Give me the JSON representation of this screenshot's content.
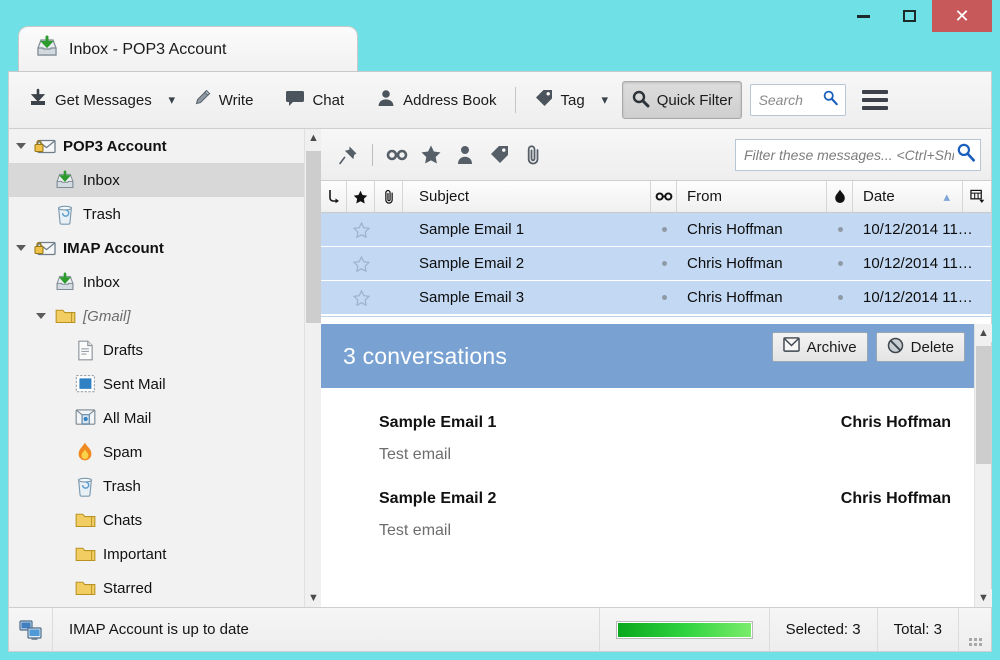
{
  "window": {
    "tab_title": "Inbox - POP3 Account",
    "tab_icon": "inbox-icon",
    "accent_cyan": "#6ee0e6",
    "close_color": "#c8595b",
    "caption": {
      "minimize_label": "Minimize",
      "maximize_label": "Maximize",
      "close_label": "Close",
      "close_glyph": "✕"
    }
  },
  "toolbar": {
    "get_messages_label": "Get Messages",
    "get_messages_caret": "▾",
    "write_label": "Write",
    "chat_label": "Chat",
    "address_book_label": "Address Book",
    "tag_label": "Tag",
    "tag_caret": "▾",
    "quick_filter_label": "Quick Filter",
    "quick_filter_pressed": true,
    "search_placeholder": "Search",
    "menu_label": "Menu"
  },
  "folder_pane": {
    "items": [
      {
        "label": "POP3 Account",
        "icon": "account-mail-lock-icon",
        "indent": 0,
        "twisty": "open",
        "kind": "account",
        "selected": false
      },
      {
        "label": "Inbox",
        "icon": "inbox-icon",
        "indent": 1,
        "twisty": "none",
        "kind": "folder",
        "selected": true
      },
      {
        "label": "Trash",
        "icon": "trash-icon",
        "indent": 1,
        "twisty": "none",
        "kind": "folder",
        "selected": false
      },
      {
        "label": "IMAP Account",
        "icon": "account-mail-lock-icon",
        "indent": 0,
        "twisty": "open",
        "kind": "account",
        "selected": false
      },
      {
        "label": "Inbox",
        "icon": "inbox-icon",
        "indent": 1,
        "twisty": "none",
        "kind": "folder",
        "selected": false
      },
      {
        "label": "[Gmail]",
        "icon": "folder-icon",
        "indent": 1,
        "twisty": "open",
        "kind": "folder-dim",
        "selected": false
      },
      {
        "label": "Drafts",
        "icon": "drafts-icon",
        "indent": 2,
        "twisty": "none",
        "kind": "folder",
        "selected": false
      },
      {
        "label": "Sent Mail",
        "icon": "sent-icon",
        "indent": 2,
        "twisty": "none",
        "kind": "folder",
        "selected": false
      },
      {
        "label": "All Mail",
        "icon": "allmail-icon",
        "indent": 2,
        "twisty": "none",
        "kind": "folder",
        "selected": false
      },
      {
        "label": "Spam",
        "icon": "spam-flame-icon",
        "indent": 2,
        "twisty": "none",
        "kind": "folder",
        "selected": false
      },
      {
        "label": "Trash",
        "icon": "trash-icon",
        "indent": 2,
        "twisty": "none",
        "kind": "folder",
        "selected": false
      },
      {
        "label": "Chats",
        "icon": "folder-icon",
        "indent": 2,
        "twisty": "none",
        "kind": "folder",
        "selected": false
      },
      {
        "label": "Important",
        "icon": "folder-icon",
        "indent": 2,
        "twisty": "none",
        "kind": "folder",
        "selected": false
      },
      {
        "label": "Starred",
        "icon": "folder-icon",
        "indent": 2,
        "twisty": "none",
        "kind": "folder",
        "selected": false
      }
    ]
  },
  "quick_filter_bar": {
    "buttons": [
      {
        "name": "pin-icon",
        "label": "Pin"
      },
      {
        "name": "unread-glasses-icon",
        "label": "Unread"
      },
      {
        "name": "starred-icon",
        "label": "Starred"
      },
      {
        "name": "contact-icon",
        "label": "Contact"
      },
      {
        "name": "tag-icon",
        "label": "Tag"
      },
      {
        "name": "attachment-icon",
        "label": "Attachment"
      }
    ],
    "filter_placeholder": "Filter these messages... <Ctrl+Shift+K>"
  },
  "message_list": {
    "columns": [
      {
        "key": "thread",
        "label": "",
        "icon": "thread-icon"
      },
      {
        "key": "star",
        "label": "",
        "icon": "star-icon"
      },
      {
        "key": "attachment",
        "label": "",
        "icon": "attachment-icon"
      },
      {
        "key": "subject",
        "label": "Subject",
        "icon": ""
      },
      {
        "key": "unread",
        "label": "",
        "icon": "unread-glasses-icon"
      },
      {
        "key": "from",
        "label": "From",
        "icon": ""
      },
      {
        "key": "junk",
        "label": "",
        "icon": "junk-flame-icon"
      },
      {
        "key": "date",
        "label": "Date",
        "icon": "",
        "sort": "▴"
      },
      {
        "key": "picker",
        "label": "",
        "icon": "column-picker-icon"
      }
    ],
    "rows": [
      {
        "subject": "Sample Email 1",
        "from": "Chris Hoffman",
        "date": "10/12/2014 11…",
        "starred": false,
        "selected": true
      },
      {
        "subject": "Sample Email 2",
        "from": "Chris Hoffman",
        "date": "10/12/2014 11…",
        "starred": false,
        "selected": true
      },
      {
        "subject": "Sample Email 3",
        "from": "Chris Hoffman",
        "date": "10/12/2014 11…",
        "starred": false,
        "selected": true
      }
    ]
  },
  "conversation": {
    "header_title": "3 conversations",
    "header_color": "#79a2d3",
    "archive_label": "Archive",
    "delete_label": "Delete",
    "messages": [
      {
        "subject": "Sample Email 1",
        "author": "Chris Hoffman",
        "snippet": "Test email"
      },
      {
        "subject": "Sample Email 2",
        "author": "Chris Hoffman",
        "snippet": "Test email"
      }
    ]
  },
  "status_bar": {
    "icon": "network-computers-icon",
    "text": "IMAP Account is up to date",
    "progress_percent": 100,
    "progress_color": "#2fd33f",
    "selected_label": "Selected: 3",
    "total_label": "Total: 3"
  }
}
